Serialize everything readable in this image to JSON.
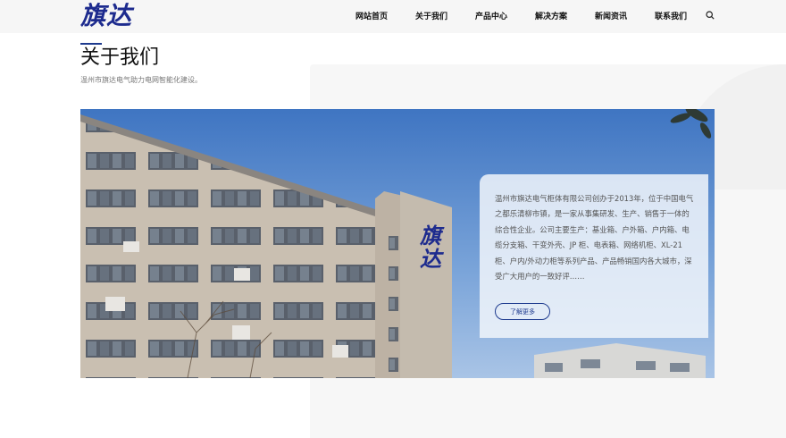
{
  "header": {
    "logo_text": "旗达",
    "nav": [
      "网站首页",
      "关于我们",
      "产品中心",
      "解决方案",
      "新闻资讯",
      "联系我们"
    ],
    "search_icon": "search-icon"
  },
  "section": {
    "title": "关于我们",
    "subtitle": "温州市旗达电气助力电网智能化建设。"
  },
  "photo": {
    "building_logo": "旗达"
  },
  "card": {
    "text": "温州市旗达电气柜体有限公司创办于2013年，位于中国电气之都乐清柳市镇，是一家从事集研发、生产、销售于一体的综合性企业。公司主要生产：基业箱、户外箱、户内箱、电缆分支箱、干变外壳、JP 柜、电表箱、网络机柜、XL-21 柜、户内/外动力柜等系列产品、产品畅销国内各大城市，深受广大用户的一致好评……",
    "button_label": "了解更多"
  },
  "colors": {
    "brand": "#1d2b8e",
    "sky": "#5a8bd0",
    "building": "#c7bcae"
  }
}
